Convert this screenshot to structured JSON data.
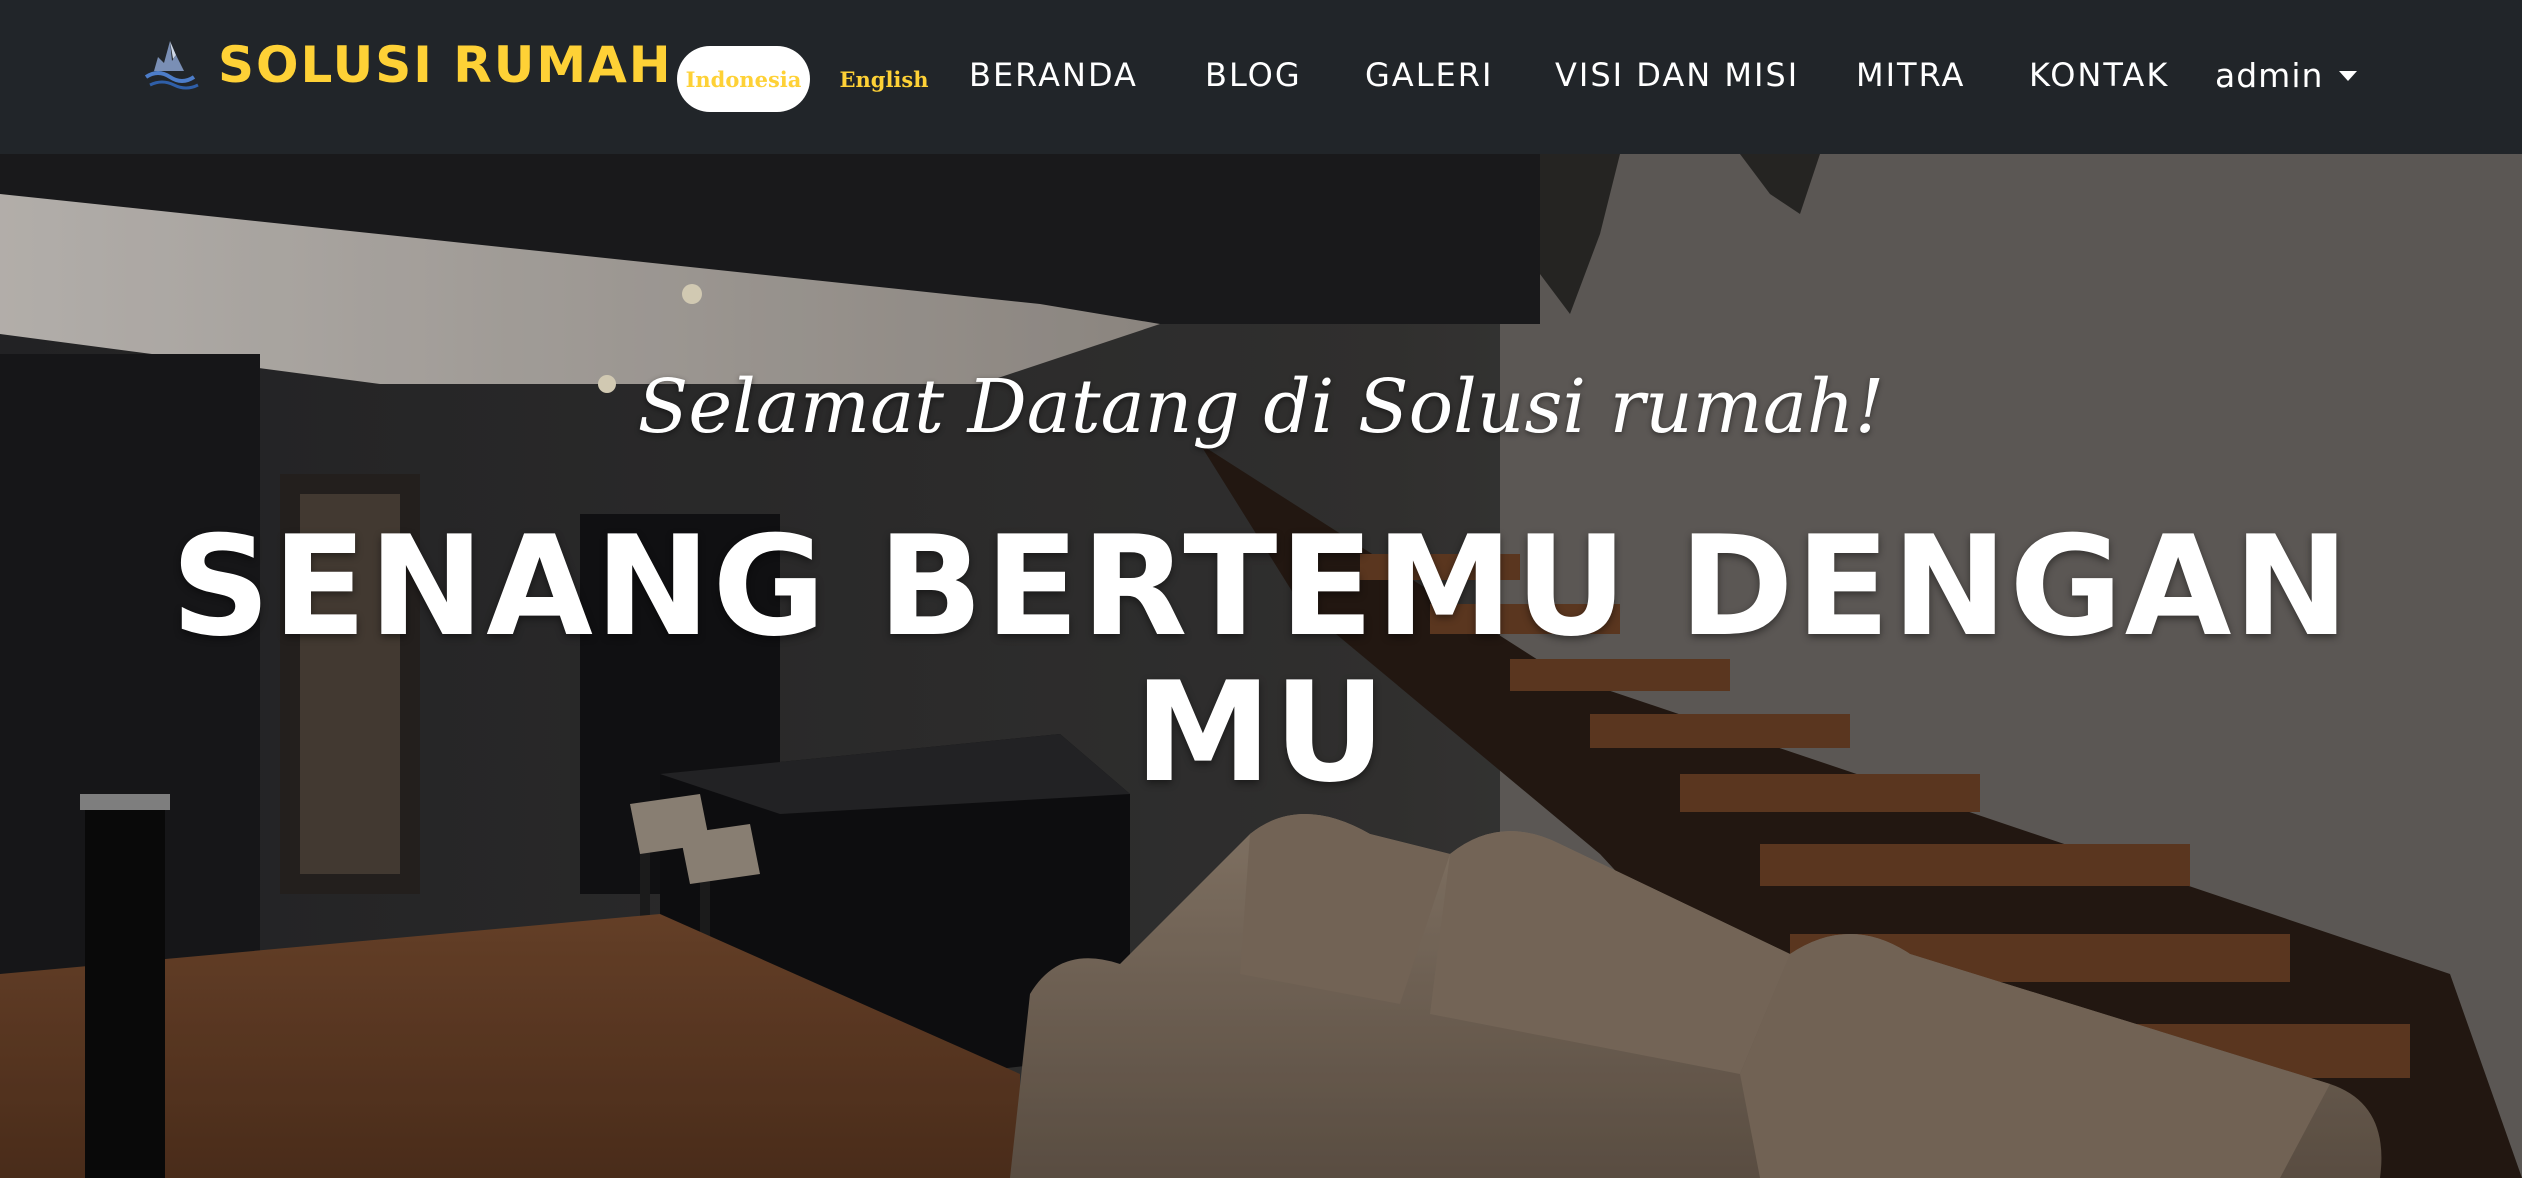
{
  "brand": {
    "name": "SOLUSI RUMAH",
    "logo_icon": "mountain-water-logo-icon"
  },
  "language": {
    "options": [
      "Indonesia",
      "English"
    ],
    "active": "Indonesia"
  },
  "nav": {
    "items": [
      "BERANDA",
      "BLOG",
      "GALERI",
      "VISI DAN MISI",
      "MITRA",
      "KONTAK"
    ],
    "user_menu": {
      "label": "admin",
      "icon": "caret-down-icon"
    }
  },
  "hero": {
    "subtitle": "Selamat Datang di Solusi rumah!",
    "heading": "SENANG BERTEMU DENGAN MU"
  },
  "colors": {
    "navbar_bg": "#212529",
    "accent": "#fed136",
    "text": "#ffffff"
  }
}
